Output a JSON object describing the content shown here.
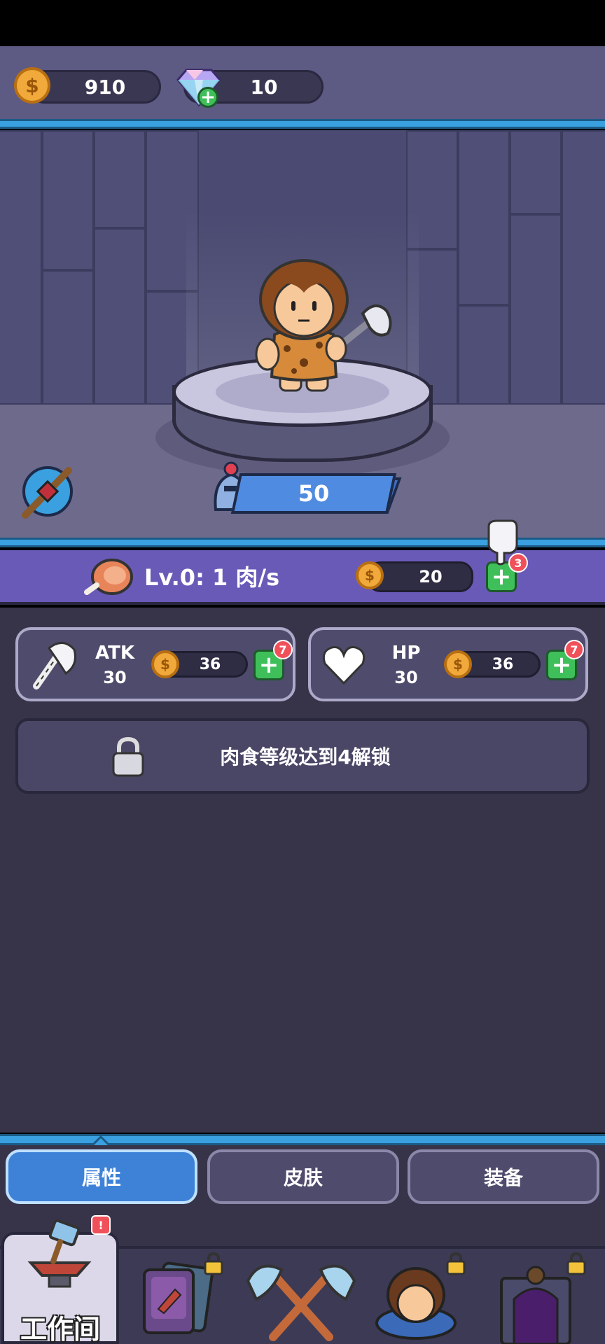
{
  "currency": {
    "coins": "910",
    "gems": "10"
  },
  "hero": {
    "hp_banner": "50"
  },
  "meat": {
    "level_text": "Lv.0: 1 肉/s",
    "upgrade_cost": "20",
    "badge": "3"
  },
  "stats": [
    {
      "name": "ATK",
      "value": "30",
      "cost": "36",
      "badge": "7"
    },
    {
      "name": "HP",
      "value": "30",
      "cost": "36",
      "badge": "7"
    }
  ],
  "locked": {
    "text": "肉食等级达到4解锁"
  },
  "tabs": [
    {
      "label": "属性",
      "active": true
    },
    {
      "label": "皮肤",
      "active": false
    },
    {
      "label": "装备",
      "active": false
    }
  ],
  "nav": {
    "active_label": "工作间",
    "alert": "!"
  },
  "colors": {
    "accent_blue": "#3aa0e0",
    "panel": "#37344a",
    "meat_bar": "#6a5ab8",
    "plus_green": "#3fbf5a"
  }
}
